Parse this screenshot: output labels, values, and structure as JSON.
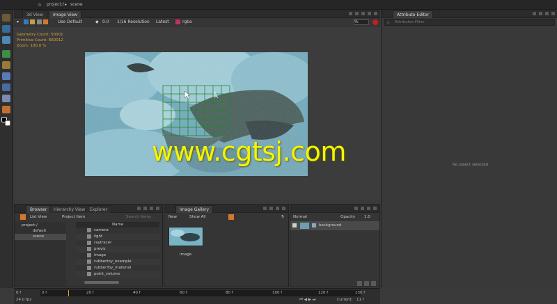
{
  "breadcrumb": {
    "project": "project:/",
    "scene": "scene"
  },
  "viewer": {
    "tabs": [
      "3d View",
      "Image View"
    ],
    "toolbar": {
      "display_mode": "Use Default",
      "exposure": "0.0",
      "resolution": "1/16 Resolution",
      "version": "Latest",
      "channels": "rgba",
      "percent": "%"
    },
    "stats": {
      "geometry": "Geometry Count: 50001",
      "primitives": "Primitive Count: 660012",
      "zoom": "Zoom: 100.0 %"
    }
  },
  "attribute_editor": {
    "title": "Attribute Editor",
    "filter_placeholder": "Attributes Filter",
    "empty": "No object selected"
  },
  "browser": {
    "tabs": [
      "Browser",
      "Hierarchy View",
      "Explorer"
    ],
    "view_mode": "List View",
    "item_type": "Project Item",
    "search_placeholder": "Search Items",
    "tree": [
      "project:/",
      "default",
      "scene"
    ],
    "name_header": "Name",
    "items": [
      "camera",
      "light",
      "raytracer",
      "previz",
      "image",
      "rubbertoy_example",
      "rubberToy_material",
      "point_volume"
    ]
  },
  "gallery": {
    "title": "Image Gallery",
    "new_label": "New",
    "filter": "Show All",
    "thumb_label": "image"
  },
  "layers": {
    "blend": "Normal",
    "opacity_label": "Opacity",
    "opacity_value": "1.0",
    "layer_name": "background"
  },
  "timeline": {
    "ticks": [
      "0 f",
      "20 f",
      "40 f",
      "60 f",
      "80 f",
      "100 f",
      "120 f"
    ],
    "start": "0 f",
    "end": "130 f",
    "fps": "24.0 fps",
    "current_label": "Current:",
    "current_value": "11 f"
  },
  "watermark": "www.cgtsj.com",
  "colors": {
    "accent": "#d9a43a",
    "watermark": "#f4f500",
    "grid": "#1f8a2a"
  }
}
